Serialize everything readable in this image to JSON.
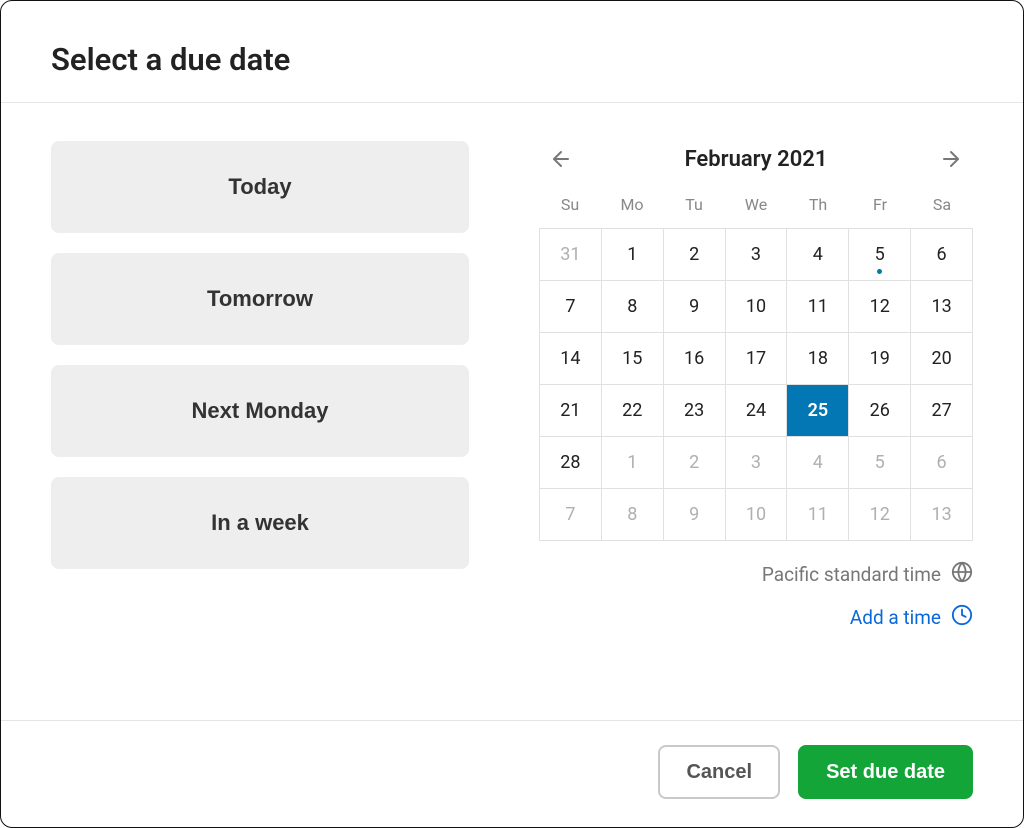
{
  "header": {
    "title": "Select a due date"
  },
  "quick": {
    "today": "Today",
    "tomorrow": "Tomorrow",
    "next_monday": "Next Monday",
    "in_a_week": "In a week"
  },
  "calendar": {
    "month_label": "February 2021",
    "dow": [
      "Su",
      "Mo",
      "Tu",
      "We",
      "Th",
      "Fr",
      "Sa"
    ],
    "days": [
      {
        "n": "31",
        "out": true
      },
      {
        "n": "1"
      },
      {
        "n": "2"
      },
      {
        "n": "3"
      },
      {
        "n": "4"
      },
      {
        "n": "5",
        "today": true
      },
      {
        "n": "6"
      },
      {
        "n": "7"
      },
      {
        "n": "8"
      },
      {
        "n": "9"
      },
      {
        "n": "10"
      },
      {
        "n": "11"
      },
      {
        "n": "12"
      },
      {
        "n": "13"
      },
      {
        "n": "14"
      },
      {
        "n": "15"
      },
      {
        "n": "16"
      },
      {
        "n": "17"
      },
      {
        "n": "18"
      },
      {
        "n": "19"
      },
      {
        "n": "20"
      },
      {
        "n": "21"
      },
      {
        "n": "22"
      },
      {
        "n": "23"
      },
      {
        "n": "24"
      },
      {
        "n": "25",
        "selected": true
      },
      {
        "n": "26"
      },
      {
        "n": "27"
      },
      {
        "n": "28"
      },
      {
        "n": "1",
        "out": true
      },
      {
        "n": "2",
        "out": true
      },
      {
        "n": "3",
        "out": true
      },
      {
        "n": "4",
        "out": true
      },
      {
        "n": "5",
        "out": true
      },
      {
        "n": "6",
        "out": true
      },
      {
        "n": "7",
        "out": true
      },
      {
        "n": "8",
        "out": true
      },
      {
        "n": "9",
        "out": true
      },
      {
        "n": "10",
        "out": true
      },
      {
        "n": "11",
        "out": true
      },
      {
        "n": "12",
        "out": true
      },
      {
        "n": "13",
        "out": true
      }
    ]
  },
  "timezone": {
    "label": "Pacific standard time"
  },
  "add_time": {
    "label": "Add a time"
  },
  "footer": {
    "cancel": "Cancel",
    "set": "Set due date"
  }
}
